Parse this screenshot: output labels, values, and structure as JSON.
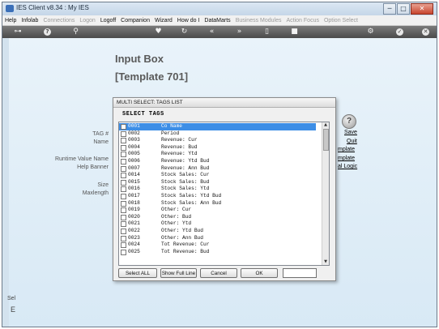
{
  "window": {
    "title": "IES Client v8.34 : My IES",
    "minimize": "─",
    "maximize": "□",
    "close": "✕"
  },
  "menu": [
    {
      "label": "Help",
      "enabled": true
    },
    {
      "label": "Infolab",
      "enabled": true
    },
    {
      "label": "Connections",
      "enabled": false
    },
    {
      "label": "Logon",
      "enabled": false
    },
    {
      "label": "Logoff",
      "enabled": true
    },
    {
      "label": "Companion",
      "enabled": true
    },
    {
      "label": "Wizard",
      "enabled": true
    },
    {
      "label": "How do I",
      "enabled": true
    },
    {
      "label": "DataMarts",
      "enabled": true
    },
    {
      "label": "Business Modules",
      "enabled": false
    },
    {
      "label": "Action Focus",
      "enabled": false
    },
    {
      "label": "Option Select",
      "enabled": false
    }
  ],
  "toolbar": {
    "icons": [
      "key-icon",
      "help-icon",
      "search-icon",
      "heart-icon",
      "refresh-icon",
      "back-icon",
      "forward-icon",
      "document-icon",
      "stop-icon",
      "gear-icon",
      "check-icon",
      "close-icon"
    ]
  },
  "page": {
    "title": "Input Box",
    "subtitle": "[Template 701]",
    "field_labels": [
      "TAG #",
      "Name",
      "Runtime Value Name",
      "Help Banner",
      "Size",
      "Maxlength"
    ],
    "links": [
      "Save",
      "Quit",
      "mplate",
      "mplate",
      "al Logic"
    ],
    "help_glyph": "?",
    "bottom_labels": [
      "Sel",
      "E"
    ]
  },
  "dialog": {
    "title": "MULTI SELECT: TAGS LIST",
    "heading": "SELECT TAGS",
    "items": [
      {
        "code": "0001",
        "name": "Co Name",
        "selected": true
      },
      {
        "code": "0002",
        "name": "Period",
        "selected": false
      },
      {
        "code": "0003",
        "name": "Revenue: Cur",
        "selected": false
      },
      {
        "code": "0004",
        "name": "Revenue: Bud",
        "selected": false
      },
      {
        "code": "0005",
        "name": "Revenue: Ytd",
        "selected": false
      },
      {
        "code": "0006",
        "name": "Revenue: Ytd Bud",
        "selected": false
      },
      {
        "code": "0007",
        "name": "Revenue: Ann Bud",
        "selected": false
      },
      {
        "code": "0014",
        "name": "Stock Sales: Cur",
        "selected": false
      },
      {
        "code": "0015",
        "name": "Stock Sales: Bud",
        "selected": false
      },
      {
        "code": "0016",
        "name": "Stock Sales: Ytd",
        "selected": false
      },
      {
        "code": "0017",
        "name": "Stock Sales: Ytd Bud",
        "selected": false
      },
      {
        "code": "0018",
        "name": "Stock Sales: Ann Bud",
        "selected": false
      },
      {
        "code": "0019",
        "name": "Other: Cur",
        "selected": false
      },
      {
        "code": "0020",
        "name": "Other: Bud",
        "selected": false
      },
      {
        "code": "0021",
        "name": "Other: Ytd",
        "selected": false
      },
      {
        "code": "0022",
        "name": "Other: Ytd Bud",
        "selected": false
      },
      {
        "code": "0023",
        "name": "Other: Ann Bud",
        "selected": false
      },
      {
        "code": "0024",
        "name": "Tot Revenue: Cur",
        "selected": false
      },
      {
        "code": "0025",
        "name": "Tot Revenue: Bud",
        "selected": false
      }
    ],
    "buttons": {
      "select_all": "Select ALL",
      "show_full_line": "Show Full Line",
      "cancel": "Cancel",
      "ok": "OK"
    },
    "input_value": "",
    "scroll_up": "▲",
    "scroll_down": "▼"
  }
}
